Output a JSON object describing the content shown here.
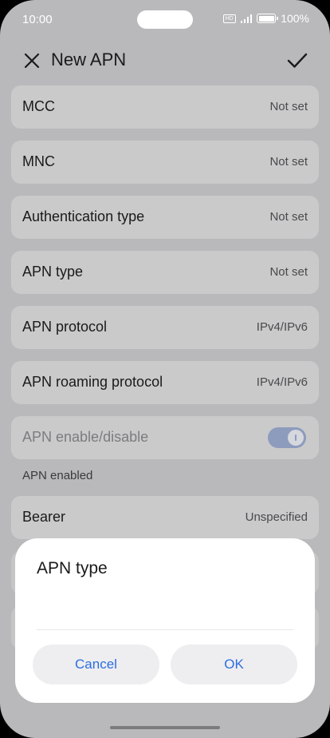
{
  "status_bar": {
    "time": "10:00",
    "hd_label": "HD",
    "battery": "100%"
  },
  "header": {
    "title": "New APN",
    "close_icon": "close-icon",
    "save_icon": "check-icon"
  },
  "rows": [
    {
      "label": "MCC",
      "value": "Not set"
    },
    {
      "label": "MNC",
      "value": "Not set"
    },
    {
      "label": "Authentication type",
      "value": "Not set"
    },
    {
      "label": "APN type",
      "value": "Not set"
    },
    {
      "label": "APN protocol",
      "value": "IPv4/IPv6"
    },
    {
      "label": "APN roaming protocol",
      "value": "IPv4/IPv6"
    }
  ],
  "apn_toggle": {
    "label": "APN enable/disable",
    "state": "on",
    "sub_label": "APN enabled"
  },
  "bearer": {
    "label": "Bearer",
    "value": "Unspecified"
  },
  "dialog": {
    "title": "APN type",
    "cancel_label": "Cancel",
    "ok_label": "OK"
  },
  "colors": {
    "accent": "#2d6ee0",
    "toggle_on_disabled": "#8d9bbd"
  }
}
